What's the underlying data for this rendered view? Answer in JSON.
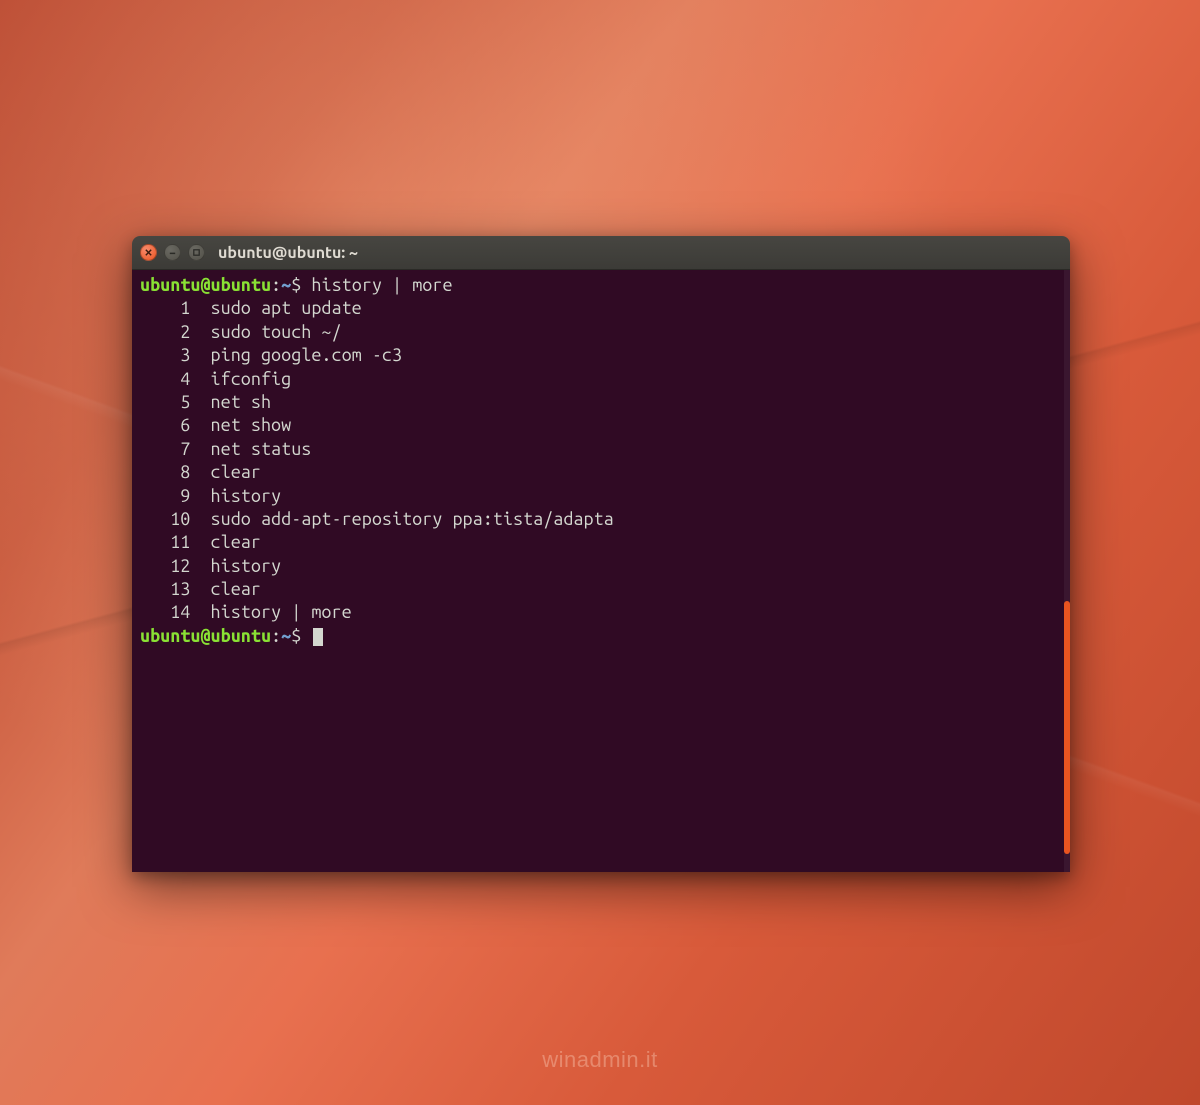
{
  "window": {
    "title": "ubuntu@ubuntu: ~"
  },
  "prompt": {
    "user_host": "ubuntu@ubuntu",
    "colon": ":",
    "path": "~",
    "symbol": "$"
  },
  "command_input": "history | more",
  "history": [
    {
      "num": "1",
      "cmd": "sudo apt update"
    },
    {
      "num": "2",
      "cmd": "sudo touch ~/"
    },
    {
      "num": "3",
      "cmd": "ping google.com -c3"
    },
    {
      "num": "4",
      "cmd": "ifconfig"
    },
    {
      "num": "5",
      "cmd": "net sh"
    },
    {
      "num": "6",
      "cmd": "net show"
    },
    {
      "num": "7",
      "cmd": "net status"
    },
    {
      "num": "8",
      "cmd": "clear"
    },
    {
      "num": "9",
      "cmd": "history"
    },
    {
      "num": "10",
      "cmd": "sudo add-apt-repository ppa:tista/adapta"
    },
    {
      "num": "11",
      "cmd": "clear"
    },
    {
      "num": "12",
      "cmd": "history"
    },
    {
      "num": "13",
      "cmd": "clear"
    },
    {
      "num": "14",
      "cmd": "history | more"
    }
  ],
  "watermark": "winadmin.it"
}
